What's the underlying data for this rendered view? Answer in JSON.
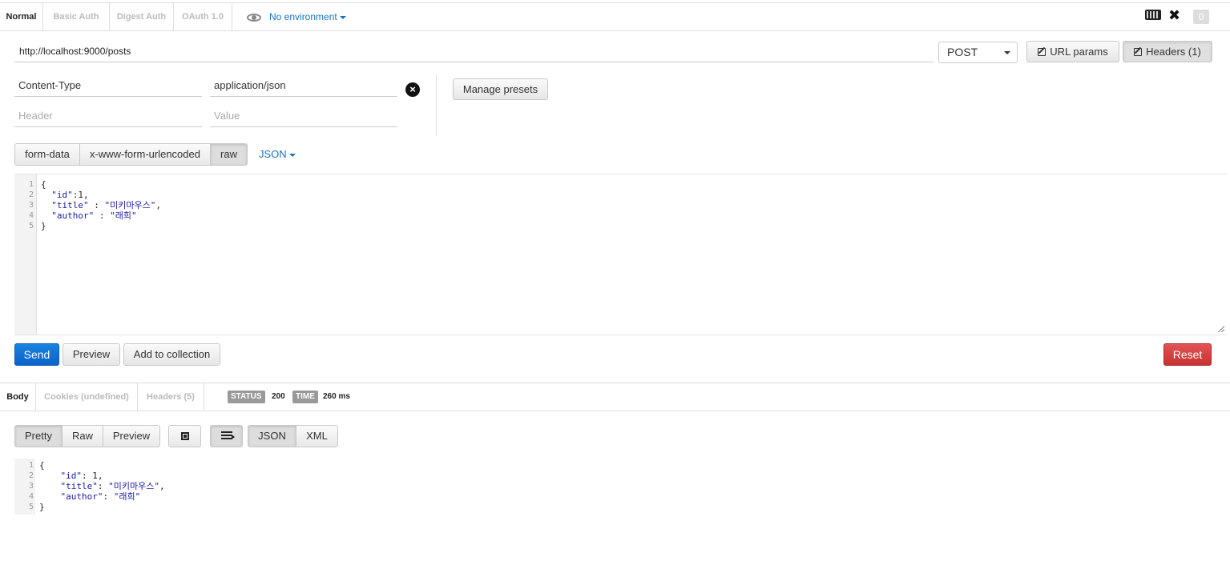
{
  "auth_tabs": [
    "Normal",
    "Basic Auth",
    "Digest Auth",
    "OAuth 1.0"
  ],
  "environment": "No environment",
  "counter": "0",
  "url": "http://localhost:9000/posts",
  "method": "POST",
  "buttons": {
    "url_params": "URL params",
    "headers": "Headers (1)",
    "manage_presets": "Manage presets",
    "send": "Send",
    "preview": "Preview",
    "add_to_collection": "Add to collection",
    "reset": "Reset"
  },
  "headers": {
    "key": "Content-Type",
    "value": "application/json",
    "key_placeholder": "Header",
    "value_placeholder": "Value"
  },
  "body_modes": [
    "form-data",
    "x-www-form-urlencoded",
    "raw"
  ],
  "raw_format": "JSON",
  "request_body": {
    "line_numbers": [
      "1",
      "2",
      "3",
      "4",
      "5"
    ]
  },
  "response": {
    "tabs": [
      "Body",
      "Cookies (undefined)",
      "Headers (5)"
    ],
    "status_label": "STATUS",
    "status_value": "200",
    "time_label": "TIME",
    "time_value": "260 ms",
    "view_modes": [
      "Pretty",
      "Raw",
      "Preview"
    ],
    "formats": [
      "JSON",
      "XML"
    ],
    "line_numbers": [
      "1",
      "2",
      "3",
      "4",
      "5"
    ]
  },
  "icons": [
    "eye-icon",
    "keyboard-icon",
    "tools-icon",
    "edit-icon",
    "delete-icon",
    "caret-down-icon",
    "wrap-icon",
    "indent-icon",
    "resize-handle-icon"
  ]
}
